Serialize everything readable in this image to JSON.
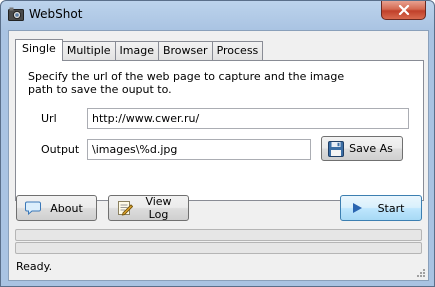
{
  "window": {
    "title": "WebShot"
  },
  "tabs": [
    {
      "label": "Single"
    },
    {
      "label": "Multiple"
    },
    {
      "label": "Image"
    },
    {
      "label": "Browser"
    },
    {
      "label": "Process"
    }
  ],
  "single": {
    "description": "Specify the url of the web page to capture and the image path to save the ouput to.",
    "url_label": "Url",
    "url_value": "http://www.cwer.ru/",
    "output_label": "Output",
    "output_value": "\\images\\%d.jpg",
    "save_as_label": "Save As"
  },
  "buttons": {
    "about": "About",
    "view_log": "View Log",
    "start": "Start"
  },
  "progress": {
    "primary": 0,
    "secondary": 0
  },
  "status": {
    "text": "Ready."
  }
}
